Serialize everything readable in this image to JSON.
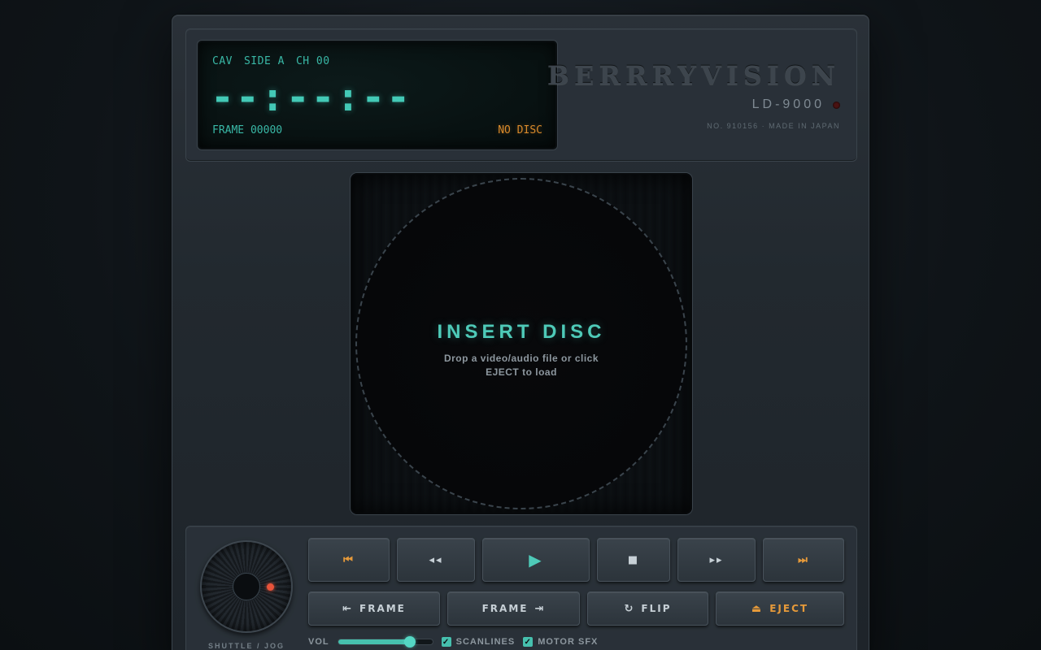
{
  "display": {
    "mode": "CAV",
    "side": "SIDE A",
    "chapter": "CH 00",
    "time": "--:--:--",
    "frame": "FRAME 00000",
    "status": "NO DISC"
  },
  "brand": {
    "name": "BERRRYVISION",
    "model": "LD-9000",
    "serial": "NO. 910156 · MADE IN JAPAN"
  },
  "tray": {
    "title": "INSERT DISC",
    "subtitle": "Drop a video/audio file or click EJECT to load"
  },
  "jog": {
    "label": "SHUTTLE / JOG"
  },
  "transport": {
    "prev_chapter": "⏮",
    "rewind": "◂◂",
    "play": "▶",
    "stop": "■",
    "fast_forward": "▸▸",
    "next_chapter": "⏭"
  },
  "actions": {
    "frame_back_icon": "⇤",
    "frame_back_label": "FRAME",
    "frame_fwd_icon": "⇥",
    "frame_fwd_label": "FRAME",
    "flip_icon": "↻",
    "flip_label": "FLIP",
    "eject_icon": "⏏",
    "eject_label": "EJECT"
  },
  "options": {
    "volume_label": "VOL",
    "volume": 0.78,
    "scanlines_label": "SCANLINES",
    "scanlines_checked": true,
    "motor_sfx_label": "MOTOR SFX",
    "motor_sfx_checked": true,
    "check_glyph": "✓"
  },
  "colors": {
    "accent_teal": "#43c9b6",
    "accent_orange": "#d98a2b",
    "led_off": "#4a1212",
    "jog_dot": "#e8533a"
  }
}
